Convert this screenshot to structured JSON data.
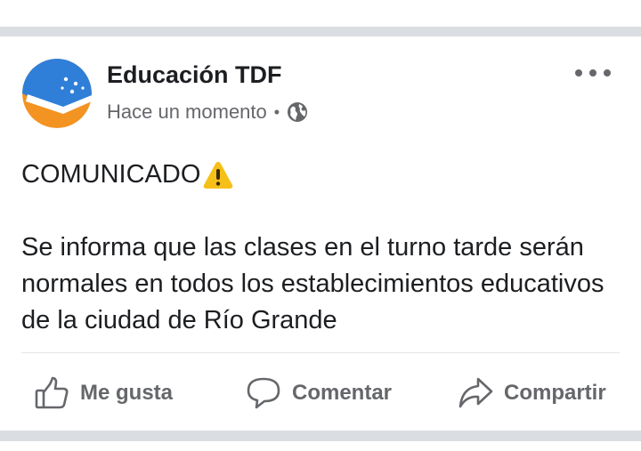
{
  "post": {
    "page_name": "Educación TDF",
    "timestamp": "Hace un momento",
    "separator": "•",
    "audience_icon": "globe-icon",
    "more_icon": "more-options-icon",
    "title": "COMUNICADO",
    "title_emoji": "warning-icon",
    "body": "Se informa que las clases en el turno tarde serán normales en todos los establecimientos educativos de la ciudad de Río Grande"
  },
  "actions": {
    "like": "Me gusta",
    "comment": "Comentar",
    "share": "Compartir"
  },
  "colors": {
    "background": "#dadde1",
    "card": "#ffffff",
    "text_primary": "#1c1e21",
    "text_secondary": "#65676b",
    "avatar_blue": "#2f7fd8",
    "avatar_orange": "#f39322",
    "warning_yellow": "#f6c018"
  }
}
